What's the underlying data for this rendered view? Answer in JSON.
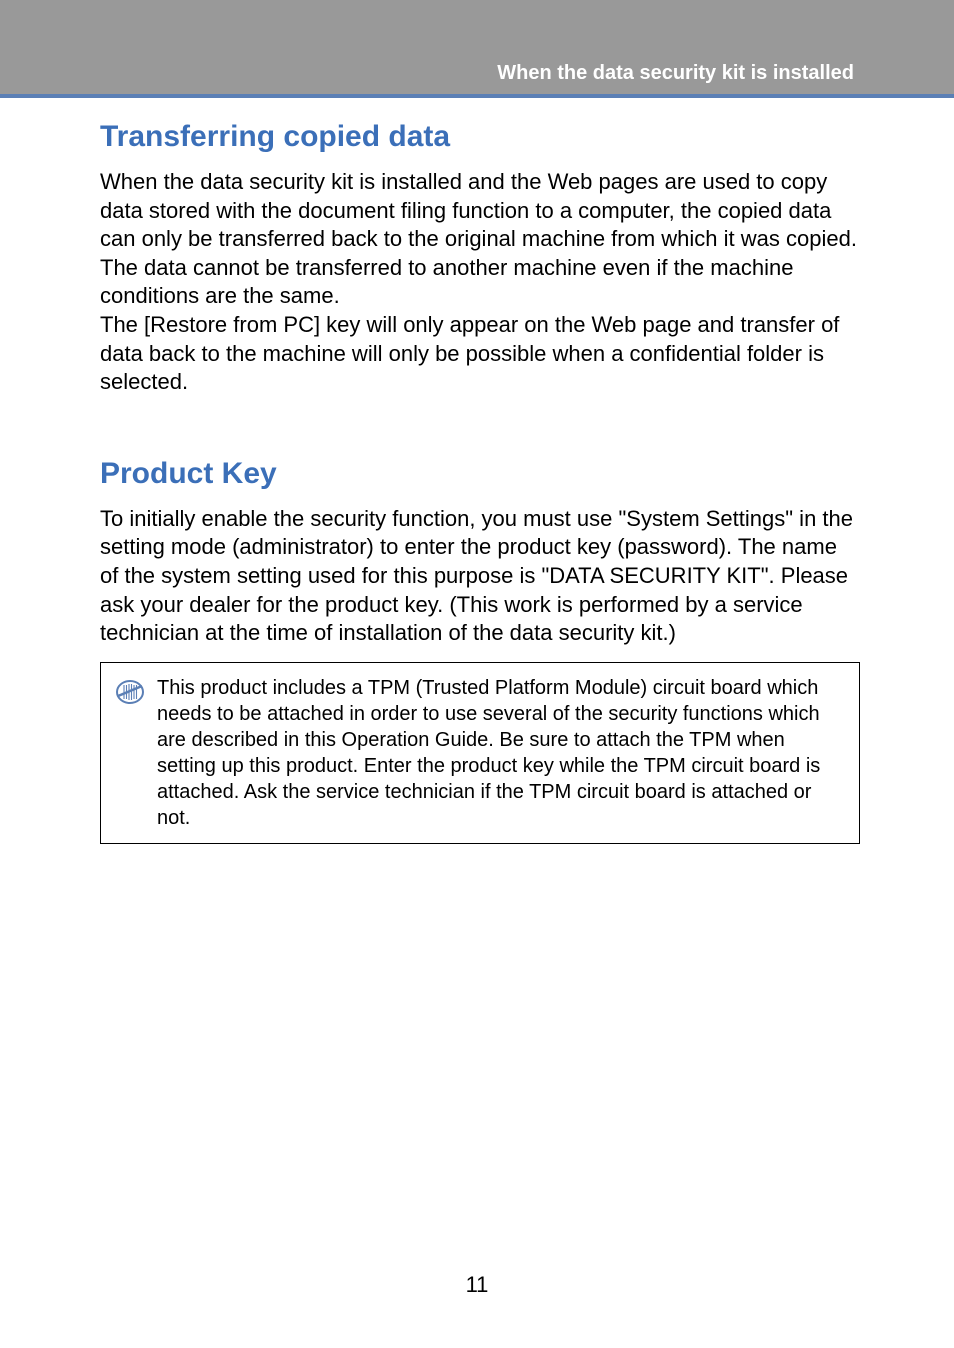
{
  "header": {
    "title": "When the data security kit is installed"
  },
  "section1": {
    "heading": "Transferring copied data",
    "para1": "When the data security kit is installed and the Web pages are used to copy data stored with the document filing function to a computer, the copied data can only be transferred back to the original machine from which it was copied.",
    "para2": "The data cannot be transferred to another machine even if the machine conditions are the same.",
    "para3": "The [Restore from PC] key will only appear on the Web page and transfer of data back to the machine will only be possible when a confidential folder is selected."
  },
  "section2": {
    "heading": "Product Key",
    "para1": "To initially enable the security function, you must use \"System Settings\" in the setting mode (administrator) to enter the product key (password). The name of the system setting used for this purpose is \"DATA SECURITY KIT\". Please ask your dealer for the product key. (This work is performed by a service technician at the time of installation of the data security kit.)",
    "note": "This product includes a TPM (Trusted Platform Module) circuit board which needs to be attached in order to use several of the security functions which are described in this Operation Guide. Be sure to attach the TPM when setting up this product. Enter the product key while the TPM circuit board is attached. Ask the service technician if the TPM circuit board is attached or not."
  },
  "pageNumber": "11"
}
